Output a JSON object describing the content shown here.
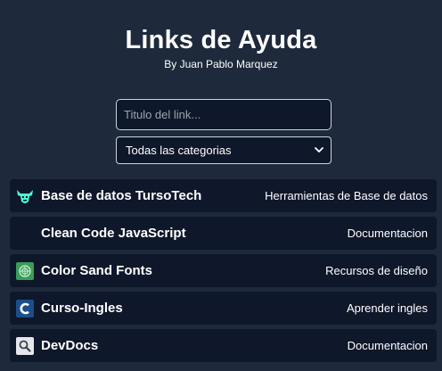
{
  "header": {
    "title": "Links de Ayuda",
    "subtitle": "By Juan Pablo Marquez"
  },
  "search": {
    "placeholder": "Titulo del link...",
    "value": ""
  },
  "category_select": {
    "selected": "Todas las categorias"
  },
  "links": [
    {
      "name": "Base de datos TursoTech",
      "category": "Herramientas de Base de datos",
      "icon": "turso-bull-icon",
      "color": "#4ff8d2"
    },
    {
      "name": "Clean Code JavaScript",
      "category": "Documentacion",
      "icon": "none",
      "color": ""
    },
    {
      "name": "Color Sand Fonts",
      "category": "Recursos de diseño",
      "icon": "colorsandfonts-icon",
      "color": "#3a9c5a"
    },
    {
      "name": "Curso-Ingles",
      "category": "Aprender ingles",
      "icon": "c-letter-icon",
      "color": "#1d4e89"
    },
    {
      "name": "DevDocs",
      "category": "Documentacion",
      "icon": "devdocs-magnifier-icon",
      "color": "#e5e7eb"
    }
  ]
}
